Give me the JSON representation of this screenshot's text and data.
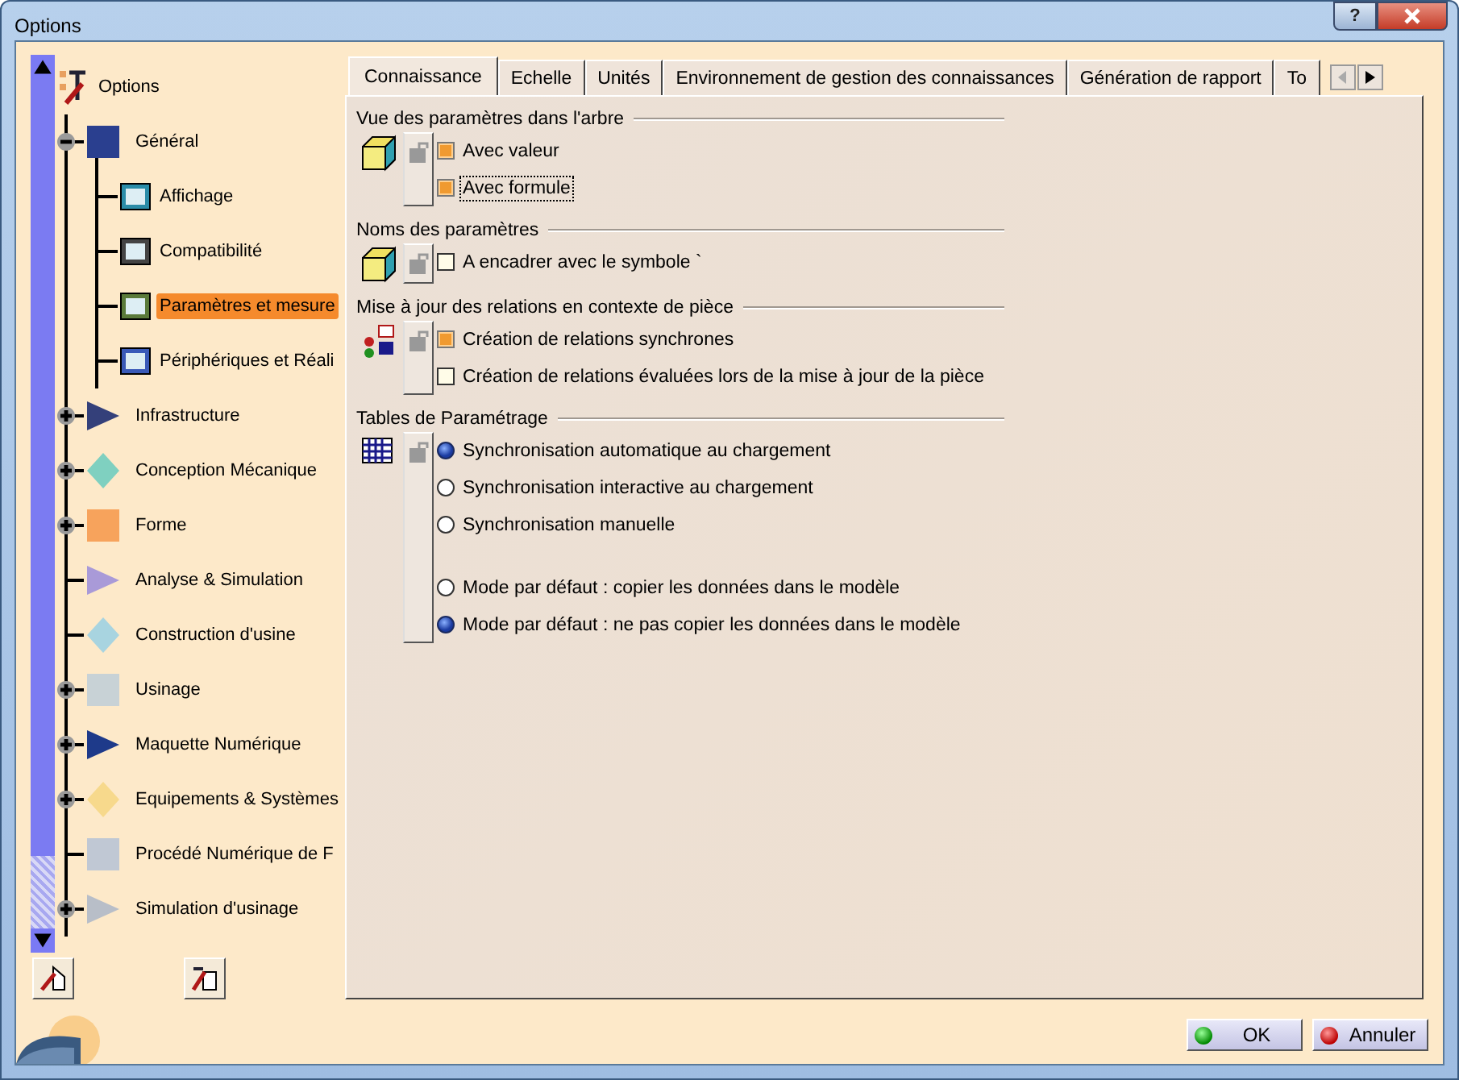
{
  "window": {
    "title": "Options",
    "help_button": "?"
  },
  "tree": {
    "label": "Options",
    "selected": false,
    "children": [
      {
        "label": "Général",
        "expanded": true,
        "selected": false,
        "children": [
          {
            "label": "Affichage",
            "selected": false
          },
          {
            "label": "Compatibilité",
            "selected": false
          },
          {
            "label": "Paramètres et mesure",
            "selected": true
          },
          {
            "label": "Périphériques et Réali",
            "selected": false
          }
        ]
      },
      {
        "label": "Infrastructure",
        "expanded": false,
        "selected": false
      },
      {
        "label": "Conception Mécanique",
        "expanded": false,
        "selected": false
      },
      {
        "label": "Forme",
        "expanded": false,
        "selected": false
      },
      {
        "label": "Analyse & Simulation",
        "selected": false
      },
      {
        "label": "Construction d'usine",
        "selected": false
      },
      {
        "label": "Usinage",
        "expanded": false,
        "selected": false
      },
      {
        "label": "Maquette Numérique",
        "expanded": false,
        "selected": false
      },
      {
        "label": "Equipements & Systèmes",
        "expanded": false,
        "selected": false
      },
      {
        "label": "Procédé Numérique de F",
        "selected": false
      },
      {
        "label": "Simulation d'usinage",
        "expanded": false,
        "selected": false
      }
    ]
  },
  "tabs": [
    {
      "label": "Connaissance",
      "selected": true
    },
    {
      "label": "Echelle",
      "selected": false
    },
    {
      "label": "Unités",
      "selected": false
    },
    {
      "label": "Environnement de gestion des connaissances",
      "selected": false
    },
    {
      "label": "Génération de rapport",
      "selected": false
    },
    {
      "label": "To",
      "selected": false
    }
  ],
  "sections": [
    {
      "title": "Vue des paramètres dans l'arbre",
      "option_groups": [
        {
          "options": [
            {
              "kind": "checkbox",
              "label": "Avec valeur",
              "checked": true,
              "focused": false
            },
            {
              "kind": "checkbox",
              "label": "Avec formule",
              "checked": true,
              "focused": true
            }
          ]
        }
      ]
    },
    {
      "title": "Noms des paramètres",
      "option_groups": [
        {
          "options": [
            {
              "kind": "checkbox",
              "label": "A encadrer avec le symbole `",
              "checked": false,
              "focused": false
            }
          ]
        }
      ]
    },
    {
      "title": "Mise à jour des relations en contexte de pièce",
      "option_groups": [
        {
          "options": [
            {
              "kind": "checkbox",
              "label": "Création de relations synchrones",
              "checked": true,
              "focused": false
            },
            {
              "kind": "checkbox",
              "label": "Création de relations évaluées lors de la mise à jour de la pièce",
              "checked": false,
              "focused": false
            }
          ]
        }
      ]
    },
    {
      "title": "Tables de Paramétrage",
      "option_groups": [
        {
          "options": [
            {
              "kind": "radio",
              "label": "Synchronisation automatique au chargement",
              "checked": true,
              "focused": false
            },
            {
              "kind": "radio",
              "label": "Synchronisation interactive au chargement",
              "checked": false,
              "focused": false
            },
            {
              "kind": "radio",
              "label": "Synchronisation manuelle",
              "checked": false,
              "focused": false
            }
          ]
        },
        {
          "options": [
            {
              "kind": "radio",
              "label": "Mode par défaut : copier les données dans le modèle",
              "checked": false,
              "focused": false
            },
            {
              "kind": "radio",
              "label": "Mode par défaut : ne pas copier les données dans le modèle",
              "checked": true,
              "focused": false
            }
          ]
        }
      ]
    }
  ],
  "buttons": [
    {
      "kind": "ok",
      "label": "OK"
    },
    {
      "kind": "cancel",
      "label": "Annuler"
    }
  ]
}
